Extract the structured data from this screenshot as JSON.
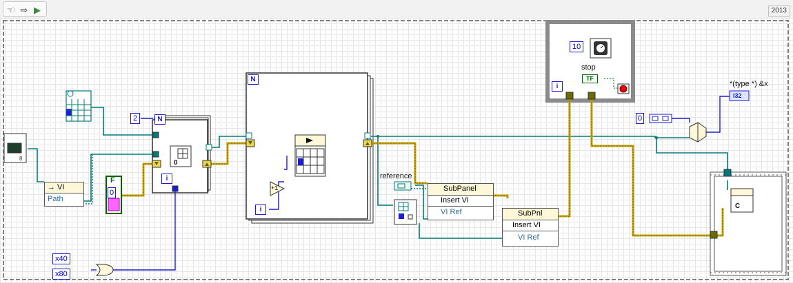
{
  "toolbar": {
    "version": "2013",
    "buttons": [
      {
        "icon": "hand-icon",
        "glyph": "☜"
      },
      {
        "icon": "arrow-right-icon",
        "glyph": "⇨"
      },
      {
        "icon": "run-vi-icon",
        "glyph": "▶"
      }
    ]
  },
  "constants": {
    "loop_count_2": "2",
    "bool_false": "F",
    "zero_num": "0",
    "wait_ms": "10",
    "mask_40": "x40",
    "mask_80": "x80",
    "const_zero_right": "0"
  },
  "labels": {
    "stop": "stop",
    "reference": "reference",
    "type_cast": "*(type *) &x",
    "i32": "I32",
    "bool_tf": "TF"
  },
  "loops": {
    "for_small_n": "N",
    "for_small_i": "i",
    "for_big_n": "N",
    "for_big_i": "i",
    "while_i": "i"
  },
  "nodes": {
    "open_vi": {
      "header": "→ VI",
      "row": "Path"
    },
    "subpanel1": {
      "header": "SubPanel",
      "row1": "Insert VI",
      "row2": "VI Ref"
    },
    "subpanel2": {
      "header": "SubPnl",
      "row1": "Insert VI",
      "row2": "VI Ref"
    },
    "increment": "+1",
    "zero_index": "0",
    "array_prim": "C"
  },
  "colors": {
    "wire_ref": "#007a7a",
    "wire_err": "#c8a400",
    "wire_int": "#1c1cd0",
    "wire_bool": "#006400",
    "frame": "#808080",
    "struct_border": "#333333"
  }
}
